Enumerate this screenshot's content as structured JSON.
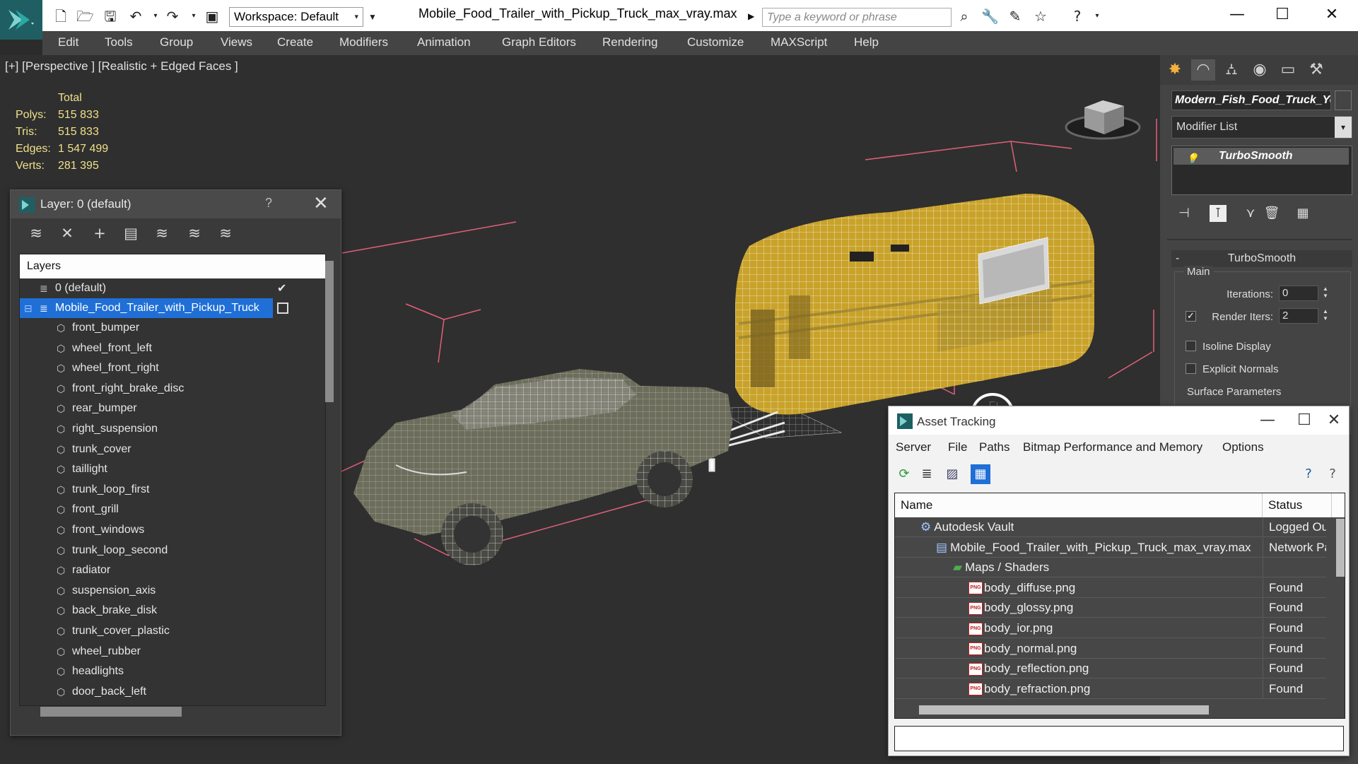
{
  "app": {
    "file_title": "Mobile_Food_Trailer_with_Pickup_Truck_max_vray.max",
    "workspace_label": "Workspace: Default",
    "search_placeholder": "Type a keyword or phrase"
  },
  "menubar": [
    "Edit",
    "Tools",
    "Group",
    "Views",
    "Create",
    "Modifiers",
    "Animation",
    "Graph Editors",
    "Rendering",
    "Customize",
    "MAXScript",
    "Help"
  ],
  "viewport": {
    "label": "[+] [Perspective ] [Realistic + Edged Faces ]",
    "stats": {
      "header": "Total",
      "rows": [
        {
          "label": "Polys:",
          "value": "515 833"
        },
        {
          "label": "Tris:",
          "value": "515 833"
        },
        {
          "label": "Edges:",
          "value": "1 547 499"
        },
        {
          "label": "Verts:",
          "value": "281 395"
        }
      ]
    }
  },
  "layer_panel": {
    "title": "Layer: 0 (default)",
    "help": "?",
    "header": "Layers",
    "default_layer": "0 (default)",
    "selected_layer": "Mobile_Food_Trailer_with_Pickup_Truck",
    "objects": [
      "front_bumper",
      "wheel_front_left",
      "wheel_front_right",
      "front_right_brake_disc",
      "rear_bumper",
      "right_suspension",
      "trunk_cover",
      "taillight",
      "trunk_loop_first",
      "front_grill",
      "front_windows",
      "trunk_loop_second",
      "radiator",
      "suspension_axis",
      "back_brake_disk",
      "trunk_cover_plastic",
      "wheel_rubber",
      "headlights",
      "door_back_left"
    ]
  },
  "command_panel": {
    "object_name": "Modern_Fish_Food_Truck_Ye",
    "modifier_list": "Modifier List",
    "stack_item": "TurboSmooth",
    "rollout_title": "TurboSmooth",
    "rollout_sign": "-",
    "main_group": "Main",
    "iterations_label": "Iterations:",
    "iterations_value": "0",
    "render_iters_label": "Render Iters:",
    "render_iters_value": "2",
    "render_iters_checked": true,
    "isoline_label": "Isoline Display",
    "explicit_normals_label": "Explicit Normals",
    "surface_params_label": "Surface Parameters"
  },
  "asset_tracking": {
    "title": "Asset Tracking",
    "menu": [
      "Server",
      "File",
      "Paths",
      "Bitmap Performance and Memory",
      "Options"
    ],
    "columns": {
      "name": "Name",
      "status": "Status"
    },
    "rows": [
      {
        "name": "Autodesk Vault",
        "status": "Logged Ou",
        "icon": "vault-icon"
      },
      {
        "name": "Mobile_Food_Trailer_with_Pickup_Truck_max_vray.max",
        "status": "Network Pa",
        "icon": "max-file-icon"
      },
      {
        "name": "Maps / Shaders",
        "status": "",
        "icon": "maps-icon"
      },
      {
        "name": "body_diffuse.png",
        "status": "Found",
        "icon": "png-icon"
      },
      {
        "name": "body_glossy.png",
        "status": "Found",
        "icon": "png-icon"
      },
      {
        "name": "body_ior.png",
        "status": "Found",
        "icon": "png-icon"
      },
      {
        "name": "body_normal.png",
        "status": "Found",
        "icon": "png-icon"
      },
      {
        "name": "body_reflection.png",
        "status": "Found",
        "icon": "png-icon"
      },
      {
        "name": "body_refraction.png",
        "status": "Found",
        "icon": "png-icon"
      }
    ],
    "png_badge": "PNG"
  },
  "colors": {
    "selection": "#1f6fd6",
    "stats_text": "#f0e08a",
    "trailer": "#c9a22a",
    "bounding_box": "#e0607a"
  }
}
